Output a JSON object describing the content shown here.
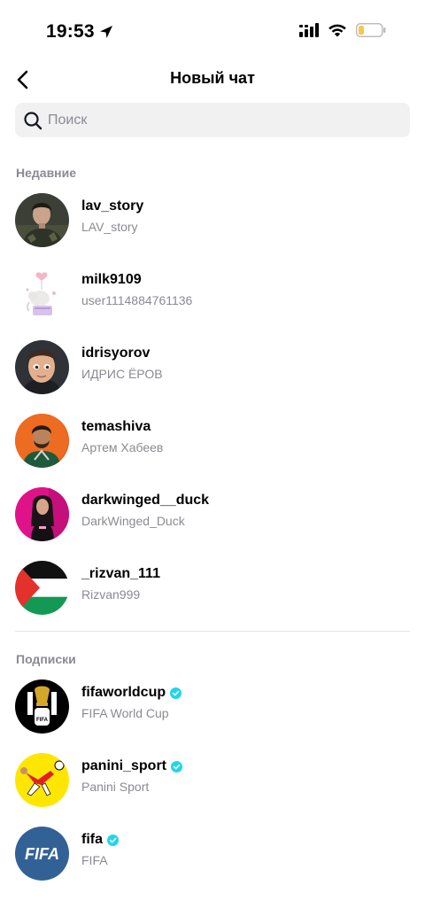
{
  "status_bar": {
    "time": "19:53",
    "icons": [
      "location-arrow-icon",
      "cellular-signal-icon",
      "wifi-icon",
      "battery-low-icon"
    ]
  },
  "header": {
    "title": "Новый чат",
    "back_icon": "chevron-left-icon"
  },
  "search": {
    "placeholder": "Поиск",
    "icon": "search-icon"
  },
  "recent": {
    "label": "Недавние",
    "items": [
      {
        "username": "lav_story",
        "nickname": "LAV_story",
        "verified": false
      },
      {
        "username": "milk9109",
        "nickname": "user1114884761136",
        "verified": false
      },
      {
        "username": "idrisyorov",
        "nickname": "ИДРИС ЁРОВ",
        "verified": false
      },
      {
        "username": "temashiva",
        "nickname": "Артем Хабеев",
        "verified": false
      },
      {
        "username": "darkwinged__duck",
        "nickname": "DarkWinged_Duck",
        "verified": false
      },
      {
        "username": "_rizvan_111",
        "nickname": "Rizvan999",
        "verified": false
      }
    ]
  },
  "following": {
    "label": "Подписки",
    "items": [
      {
        "username": "fifaworldcup",
        "nickname": "FIFA World Cup",
        "verified": true,
        "avatar_text": "FIFA"
      },
      {
        "username": "panini_sport",
        "nickname": "Panini Sport",
        "verified": true
      },
      {
        "username": "fifa",
        "nickname": "FIFA",
        "verified": true,
        "avatar_text": "FIFA"
      }
    ]
  },
  "colors": {
    "verified": "#20d5ec",
    "secondary_text": "#8a8b91",
    "search_bg": "#f1f1f2",
    "fifa_blue": "#326295",
    "panini_yellow": "#ffe600"
  }
}
